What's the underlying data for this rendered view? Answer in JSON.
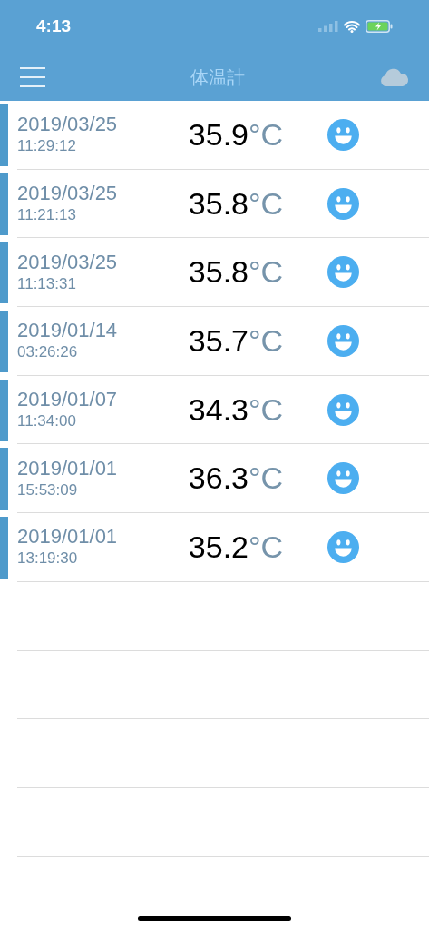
{
  "status_bar": {
    "time": "4:13"
  },
  "nav": {
    "title": "体温計"
  },
  "records": [
    {
      "date": "2019/03/25",
      "time": "11:29:12",
      "value": "35.9",
      "unit": "°C"
    },
    {
      "date": "2019/03/25",
      "time": "11:21:13",
      "value": "35.8",
      "unit": "°C"
    },
    {
      "date": "2019/03/25",
      "time": "11:13:31",
      "value": "35.8",
      "unit": "°C"
    },
    {
      "date": "2019/01/14",
      "time": "03:26:26",
      "value": "35.7",
      "unit": "°C"
    },
    {
      "date": "2019/01/07",
      "time": "11:34:00",
      "value": "34.3",
      "unit": "°C"
    },
    {
      "date": "2019/01/01",
      "time": "15:53:09",
      "value": "36.3",
      "unit": "°C"
    },
    {
      "date": "2019/01/01",
      "time": "13:19:30",
      "value": "35.2",
      "unit": "°C"
    }
  ]
}
